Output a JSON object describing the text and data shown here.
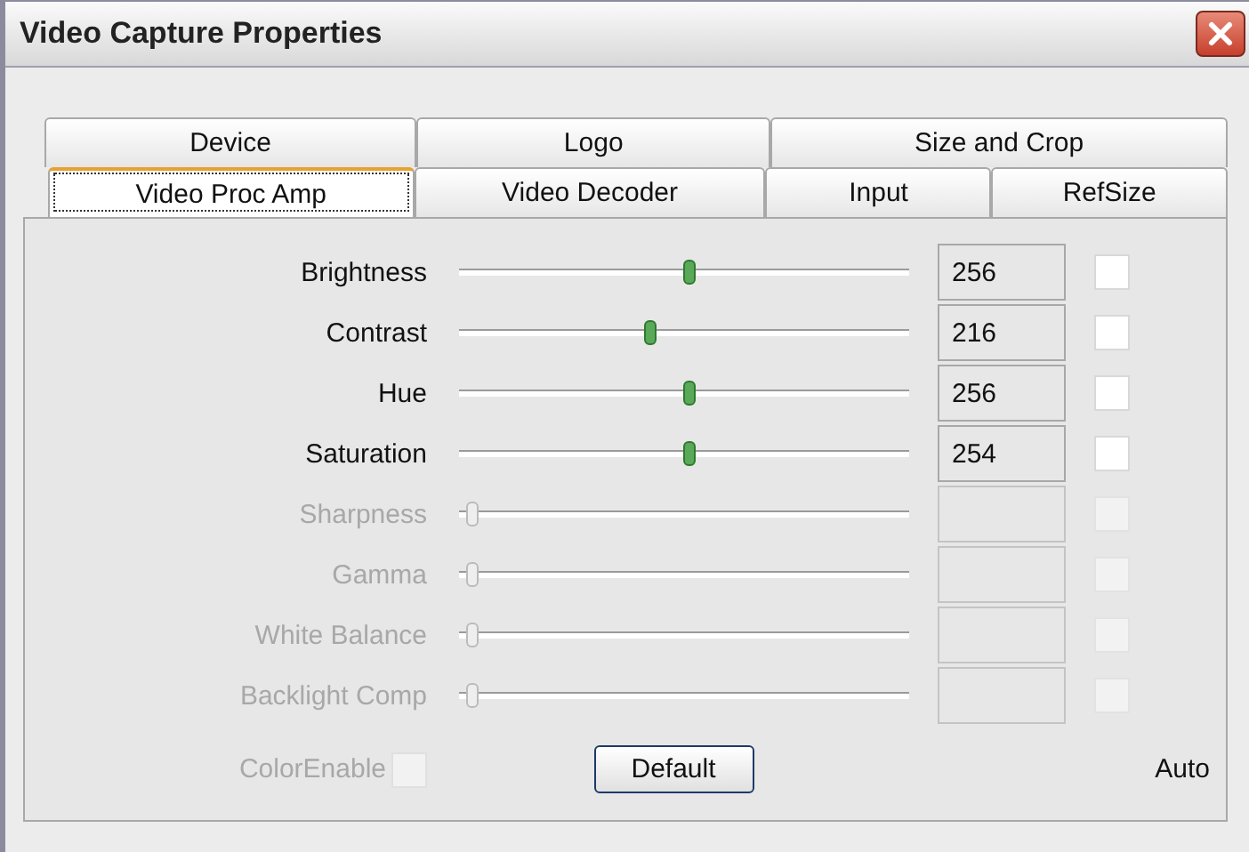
{
  "window": {
    "title": "Video Capture Properties"
  },
  "tab_rows": [
    [
      {
        "label": "Device",
        "selected": false
      },
      {
        "label": "Logo",
        "selected": false
      },
      {
        "label": "Size and Crop",
        "selected": false
      }
    ],
    [
      {
        "label": "Video Proc Amp",
        "selected": true
      },
      {
        "label": "Video Decoder",
        "selected": false
      },
      {
        "label": "Input",
        "selected": false
      },
      {
        "label": "RefSize",
        "selected": false
      }
    ]
  ],
  "controls": [
    {
      "label": "Brightness",
      "disabled": false,
      "level": 0.51,
      "value": "256",
      "auto": false
    },
    {
      "label": "Contrast",
      "disabled": false,
      "level": 0.42,
      "value": "216",
      "auto": false
    },
    {
      "label": "Hue",
      "disabled": false,
      "level": 0.51,
      "value": "256",
      "auto": false
    },
    {
      "label": "Saturation",
      "disabled": false,
      "level": 0.51,
      "value": "254",
      "auto": false
    },
    {
      "label": "Sharpness",
      "disabled": true,
      "level": 0,
      "auto": false
    },
    {
      "label": "Gamma",
      "disabled": true,
      "level": 0,
      "auto": false
    },
    {
      "label": "White Balance",
      "disabled": true,
      "level": 0,
      "auto": false
    },
    {
      "label": "Backlight Comp",
      "disabled": true,
      "level": 0,
      "auto": false
    }
  ],
  "color_enable": {
    "label": "ColorEnable",
    "disabled": true,
    "checked": false
  },
  "default_button": "Default",
  "auto_label": "Auto"
}
